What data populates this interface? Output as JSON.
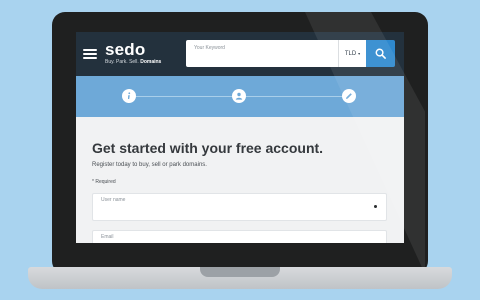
{
  "header": {
    "logo": "sedo",
    "tagline_prefix": "Buy. Park. Sell.",
    "tagline_bold": "Domains",
    "search_placeholder": "Your Keyword",
    "tld_label": "TLD",
    "tld_caret": "▾"
  },
  "steps": [
    {
      "icon": "info-icon"
    },
    {
      "icon": "user-icon"
    },
    {
      "icon": "pencil-icon"
    }
  ],
  "form": {
    "heading": "Get started with your free account.",
    "subtext": "Register today to buy, sell or park domains.",
    "required_star": "*",
    "required_label": "Required",
    "username_label": "User name",
    "email_label": "Email"
  },
  "colors": {
    "background": "#a9d3ef",
    "header": "#23313d",
    "accent": "#2e89cf",
    "steps_band": "#6ea9d8"
  }
}
